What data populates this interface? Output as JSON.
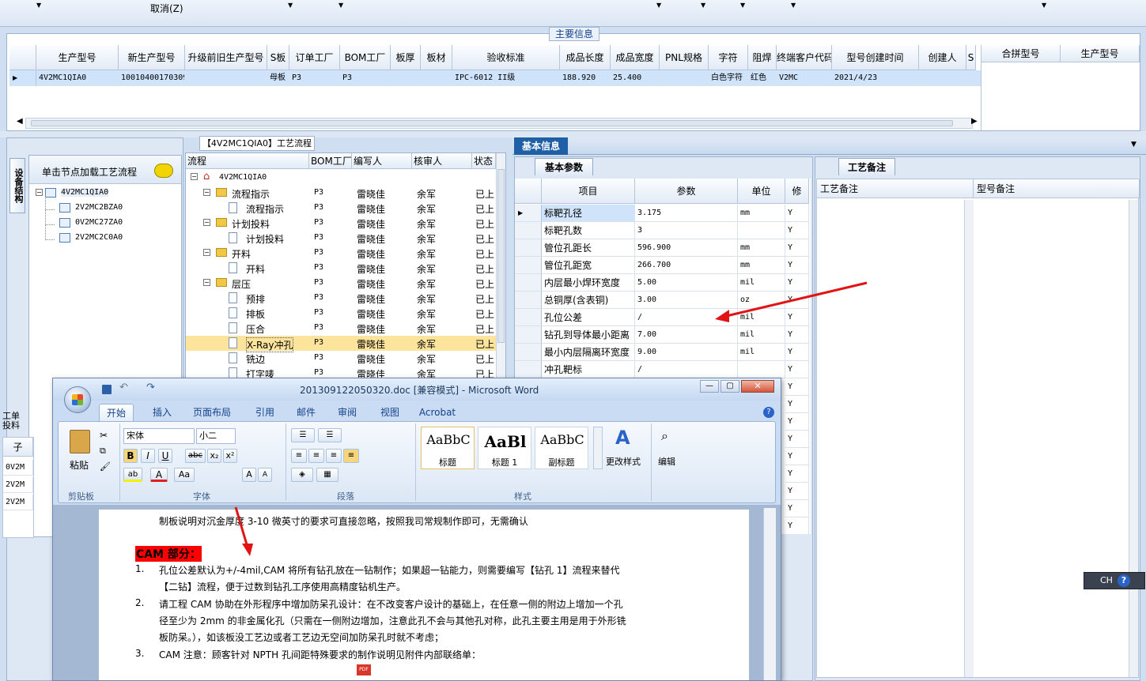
{
  "toolbar": {
    "cancel_label": "取消(Z)"
  },
  "main_info": {
    "title": "主要信息",
    "columns": [
      "生产型号",
      "新生产型号",
      "升级前旧生产型号",
      "S板",
      "订单工厂",
      "BOM工厂",
      "板厚",
      "板材",
      "验收标准",
      "成品长度",
      "成品宽度",
      "PNL规格",
      "字符",
      "阻焊",
      "终端客户代码",
      "型号创建时间",
      "创建人",
      "S"
    ],
    "row": [
      "4V2MC1QIA0",
      "10010400170309",
      "",
      "母板",
      "P3",
      "P3",
      "",
      "",
      "IPC-6012 II级",
      "188.920",
      "25.400",
      "",
      "白色字符",
      "红色",
      "V2MC",
      "2021/4/23",
      "",
      ""
    ],
    "side_columns": [
      "合拼型号",
      "生产型号"
    ]
  },
  "left_panel": {
    "vertical_tab": "设备结构",
    "hint": "单击节点加载工艺流程",
    "tree": [
      "4V2MC1QIA0",
      "2V2MC2BZA0",
      "0V2MC27ZA0",
      "2V2MC2C0A0"
    ],
    "lower_label": "工单投料",
    "lower_header": "子",
    "lower_rows": [
      "0V2M",
      "2V2M",
      "2V2M"
    ]
  },
  "process": {
    "title": "【4V2MC1QIA0】工艺流程",
    "columns": [
      "流程",
      "BOM工厂",
      "编写人",
      "核审人",
      "状态"
    ],
    "root": "4V2MC1QIA0",
    "rows": [
      {
        "name": "流程指示",
        "bom": "P3",
        "writer": "雷晓佳",
        "reviewer": "余军",
        "status": "已上",
        "type": "folder"
      },
      {
        "name": "流程指示",
        "bom": "P3",
        "writer": "雷晓佳",
        "reviewer": "余军",
        "status": "已上",
        "type": "doc"
      },
      {
        "name": "计划投料",
        "bom": "P3",
        "writer": "雷晓佳",
        "reviewer": "余军",
        "status": "已上",
        "type": "folder"
      },
      {
        "name": "计划投料",
        "bom": "P3",
        "writer": "雷晓佳",
        "reviewer": "余军",
        "status": "已上",
        "type": "doc"
      },
      {
        "name": "开料",
        "bom": "P3",
        "writer": "雷晓佳",
        "reviewer": "余军",
        "status": "已上",
        "type": "folder"
      },
      {
        "name": "开料",
        "bom": "P3",
        "writer": "雷晓佳",
        "reviewer": "余军",
        "status": "已上",
        "type": "doc"
      },
      {
        "name": "层压",
        "bom": "P3",
        "writer": "雷晓佳",
        "reviewer": "余军",
        "status": "已上",
        "type": "folder"
      },
      {
        "name": "预排",
        "bom": "P3",
        "writer": "雷晓佳",
        "reviewer": "余军",
        "status": "已上",
        "type": "doc"
      },
      {
        "name": "排板",
        "bom": "P3",
        "writer": "雷晓佳",
        "reviewer": "余军",
        "status": "已上",
        "type": "doc"
      },
      {
        "name": "压合",
        "bom": "P3",
        "writer": "雷晓佳",
        "reviewer": "余军",
        "status": "已上",
        "type": "doc"
      },
      {
        "name": "X-Ray冲孔",
        "bom": "P3",
        "writer": "雷晓佳",
        "reviewer": "余军",
        "status": "已上",
        "type": "doc"
      },
      {
        "name": "铣边",
        "bom": "P3",
        "writer": "雷晓佳",
        "reviewer": "余军",
        "status": "已上",
        "type": "doc"
      },
      {
        "name": "打字唛",
        "bom": "P3",
        "writer": "雷晓佳",
        "reviewer": "余军",
        "status": "已上",
        "type": "doc"
      }
    ]
  },
  "basic_info": {
    "title": "基本信息",
    "params_tab": "基本参数",
    "columns": [
      "项目",
      "参数",
      "单位",
      "修"
    ],
    "rows": [
      [
        "标靶孔径",
        "3.175",
        "mm",
        "Y"
      ],
      [
        "标靶孔数",
        "3",
        "",
        "Y"
      ],
      [
        "管位孔距长",
        "596.900",
        "mm",
        "Y"
      ],
      [
        "管位孔距宽",
        "266.700",
        "mm",
        "Y"
      ],
      [
        "内层最小焊环宽度",
        "5.00",
        "mil",
        "Y"
      ],
      [
        "总铜厚(含表铜)",
        "3.00",
        "oz",
        "Y"
      ],
      [
        "孔位公差",
        "/",
        "mil",
        "Y"
      ],
      [
        "钻孔到导体最小距离",
        "7.00",
        "mil",
        "Y"
      ],
      [
        "最小内层隔离环宽度",
        "9.00",
        "mil",
        "Y"
      ],
      [
        "冲孔靶标",
        "/",
        "",
        "Y"
      ]
    ],
    "extra_y": [
      "Y",
      "Y",
      "Y",
      "Y",
      "Y",
      "Y",
      "Y",
      "Y",
      "Y"
    ]
  },
  "remarks": {
    "tab": "工艺备注",
    "col1": "工艺备注",
    "col2": "型号备注"
  },
  "ime": {
    "label": "CH"
  },
  "word": {
    "title": "201309122050320.doc [兼容模式] - Microsoft Word",
    "tabs": [
      "开始",
      "插入",
      "页面布局",
      "引用",
      "邮件",
      "审阅",
      "视图",
      "Acrobat"
    ],
    "font_name": "宋体",
    "font_size": "小二",
    "groups": [
      "剪贴板",
      "字体",
      "段落",
      "样式",
      "编辑"
    ],
    "paste_label": "粘贴",
    "styles": [
      {
        "preview": "AaBbC",
        "name": "标题"
      },
      {
        "preview": "AaBl",
        "name": "标题 1"
      },
      {
        "preview": "AaBbC",
        "name": "副标题"
      }
    ],
    "change_styles": "更改样式",
    "edit_label": "编辑",
    "doc": {
      "line0": "制板说明对沉金厚度 3-10 微英寸的要求可直接忽略，按照我司常规制作即可，无需确认",
      "cam_heading": "CAM 部分：",
      "items": [
        {
          "num": "1.",
          "lines": [
            "孔位公差默认为+/-4mil,CAM 将所有钻孔放在一钻制作；如果超一钻能力，则需要编写【钻孔 1】流程来替代",
            "【二钻】流程，便于过数到钻孔工序使用高精度钻机生产。"
          ]
        },
        {
          "num": "2.",
          "lines": [
            "请工程 CAM 协助在外形程序中增加防呆孔设计：在不改变客户设计的基础上，在任意一侧的附边上增加一个孔",
            "径至少为 2mm 的非金属化孔（只需在一侧附边增加，注意此孔不会与其他孔对称，此孔主要主用是用于外形铣",
            "板防呆。），如该板没工艺边或者工艺边无空间加防呆孔时就不考虑；"
          ]
        },
        {
          "num": "3.",
          "lines": [
            "CAM 注意：顾客针对 NPTH 孔间距特殊要求的制作说明见附件内部联络单："
          ]
        }
      ]
    }
  }
}
